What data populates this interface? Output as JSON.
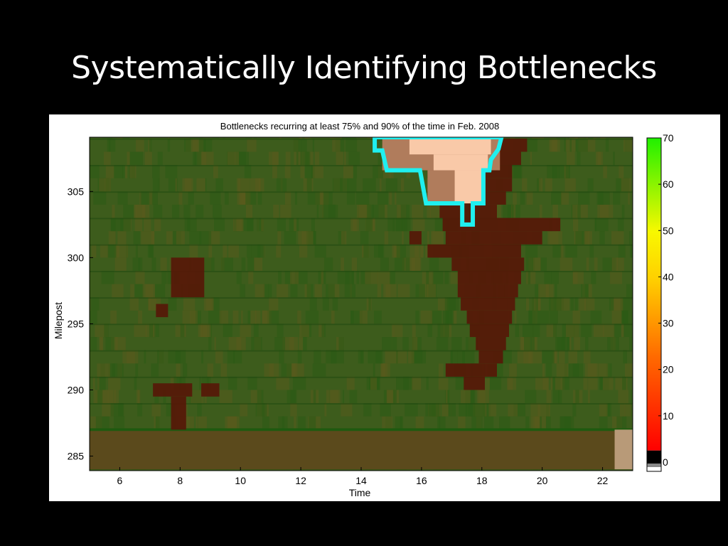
{
  "slide": {
    "title": "Systematically Identifying Bottlenecks"
  },
  "chart_data": {
    "type": "heatmap",
    "title": "Bottlenecks recurring at least 75% and 90% of the time in Feb. 2008",
    "xlabel": "Time",
    "ylabel": "Milepost",
    "xlim": [
      5,
      23
    ],
    "ylim": [
      284,
      309
    ],
    "xticks": [
      6,
      8,
      10,
      12,
      14,
      16,
      18,
      20,
      22
    ],
    "yticks": [
      285,
      290,
      295,
      300,
      305
    ],
    "colorbar": {
      "ticks": [
        0,
        10,
        20,
        30,
        40,
        50,
        60,
        70
      ],
      "range": [
        0,
        70
      ],
      "units_hint": "speed"
    },
    "colors": {
      "freeflow": "#3d5c1c",
      "congested": "#561808",
      "recur75": "#b07c5c",
      "recur90": "#f9c9a8",
      "outline": "#1ff0f0"
    },
    "congested_intervals": [
      {
        "mile": [
          308,
          309
        ],
        "time": [
          15.5,
          19.5
        ]
      },
      {
        "mile": [
          307,
          308
        ],
        "time": [
          16.0,
          19.3
        ]
      },
      {
        "mile": [
          306,
          307
        ],
        "time": [
          16.2,
          19.0
        ]
      },
      {
        "mile": [
          305,
          306
        ],
        "time": [
          16.4,
          19.0
        ]
      },
      {
        "mile": [
          304,
          305
        ],
        "time": [
          16.5,
          18.8
        ]
      },
      {
        "mile": [
          303,
          304
        ],
        "time": [
          16.6,
          18.5
        ]
      },
      {
        "mile": [
          302,
          303
        ],
        "time": [
          16.7,
          20.6
        ]
      },
      {
        "mile": [
          301,
          302
        ],
        "time": [
          16.8,
          20.0
        ]
      },
      {
        "mile": [
          300,
          301
        ],
        "time": [
          16.2,
          19.3
        ]
      },
      {
        "mile": [
          299,
          300
        ],
        "time": [
          17.0,
          19.4
        ]
      },
      {
        "mile": [
          298,
          299
        ],
        "time": [
          17.2,
          19.3
        ]
      },
      {
        "mile": [
          297,
          298
        ],
        "time": [
          17.2,
          19.2
        ]
      },
      {
        "mile": [
          296,
          297
        ],
        "time": [
          17.3,
          19.1
        ]
      },
      {
        "mile": [
          295,
          296
        ],
        "time": [
          17.5,
          19.0
        ]
      },
      {
        "mile": [
          294,
          295
        ],
        "time": [
          17.6,
          18.9
        ]
      },
      {
        "mile": [
          293,
          294
        ],
        "time": [
          17.8,
          18.8
        ]
      },
      {
        "mile": [
          292,
          293
        ],
        "time": [
          17.9,
          18.7
        ]
      },
      {
        "mile": [
          291,
          292
        ],
        "time": [
          16.8,
          18.5
        ]
      },
      {
        "mile": [
          290,
          291
        ],
        "time": [
          17.4,
          18.1
        ]
      },
      {
        "mile": [
          297,
          300
        ],
        "time": [
          7.7,
          8.8
        ]
      },
      {
        "mile": [
          295.5,
          296.5
        ],
        "time": [
          7.2,
          7.6
        ]
      },
      {
        "mile": [
          289.5,
          290.5
        ],
        "time": [
          7.1,
          8.4
        ]
      },
      {
        "mile": [
          289.5,
          290.5
        ],
        "time": [
          8.7,
          9.3
        ]
      },
      {
        "mile": [
          287,
          289.5
        ],
        "time": [
          7.7,
          8.2
        ]
      },
      {
        "mile": [
          301,
          302
        ],
        "time": [
          15.6,
          16.0
        ]
      }
    ],
    "bottom_band": {
      "mile": [
        284,
        287
      ],
      "color": "#5b4a1c"
    },
    "bottom_light": {
      "mile": [
        284,
        287
      ],
      "time": [
        22.4,
        23
      ],
      "color": "#b89a78"
    },
    "recur75_regions": [
      {
        "mile": [
          306.6,
          309
        ],
        "time": [
          14.7,
          18.6
        ]
      },
      {
        "mile": [
          304.1,
          306.6
        ],
        "time": [
          16.2,
          18.1
        ]
      }
    ],
    "recur90_regions": [
      {
        "mile": [
          307.8,
          309
        ],
        "time": [
          15.6,
          18.3
        ]
      },
      {
        "mile": [
          306.6,
          307.8
        ],
        "time": [
          16.4,
          18.2
        ]
      },
      {
        "mile": [
          304.1,
          306.6
        ],
        "time": [
          17.1,
          18.0
        ]
      }
    ],
    "outline": [
      [
        14.45,
        309.1
      ],
      [
        18.65,
        309.1
      ],
      [
        18.55,
        308.2
      ],
      [
        18.3,
        307.4
      ],
      [
        18.25,
        306.6
      ],
      [
        18.05,
        306.6
      ],
      [
        18.05,
        304.1
      ],
      [
        17.7,
        304.1
      ],
      [
        17.7,
        302.5
      ],
      [
        17.35,
        302.5
      ],
      [
        17.35,
        304.1
      ],
      [
        16.15,
        304.1
      ],
      [
        15.95,
        306.6
      ],
      [
        14.85,
        306.6
      ],
      [
        14.7,
        308.1
      ],
      [
        14.45,
        308.1
      ]
    ]
  }
}
